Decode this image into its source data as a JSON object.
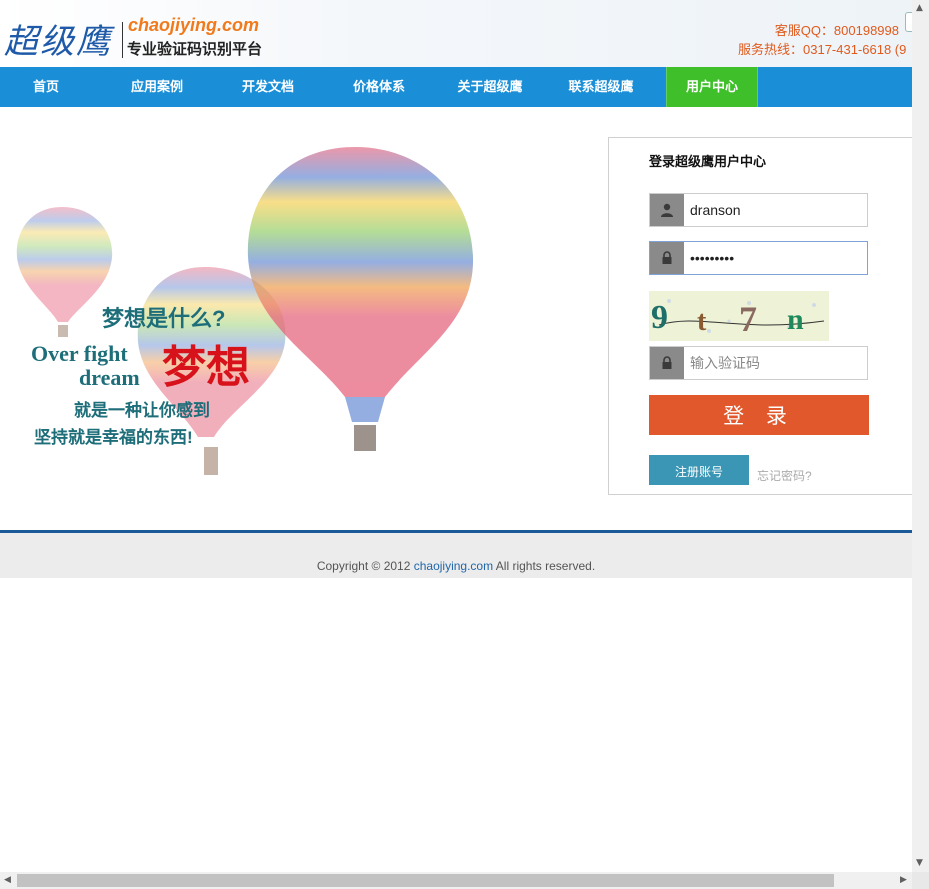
{
  "header": {
    "logo_cn": "超级鹰",
    "logo_domain": "chaojiying.com",
    "logo_slogan": "专业验证码识别平台",
    "contact_qq": "客服QQ：800198998",
    "contact_phone": "服务热线：0317-431-6618 (9"
  },
  "nav": {
    "items": [
      {
        "label": "首页"
      },
      {
        "label": "应用案例"
      },
      {
        "label": "开发文档"
      },
      {
        "label": "价格体系"
      },
      {
        "label": "关于超级鹰"
      },
      {
        "label": "联系超级鹰"
      },
      {
        "label": "用户中心",
        "active": true
      }
    ]
  },
  "banner": {
    "question": "梦想是什么?",
    "english_line1": "Over fight",
    "english_line2": "dream",
    "dream": "梦想",
    "line1": "就是一种让你感到",
    "line2": "坚持就是幸福的东西!"
  },
  "login": {
    "title": "登录超级鹰用户中心",
    "username_value": "dranson",
    "password_value": "•••••••••",
    "captcha_text": "9 t 7 n",
    "captcha_placeholder": "输入验证码",
    "login_button": "登 录",
    "register_button": "注册账号",
    "forgot_link": "忘记密码?"
  },
  "footer": {
    "prefix": "Copyright © 2012 ",
    "link": "chaojiying.com",
    "suffix": " All rights reserved."
  },
  "colors": {
    "nav_bg": "#1a8fd7",
    "nav_active": "#3fbf2a",
    "login_button": "#e0582b",
    "register_button": "#3a96b4",
    "accent_orange": "#f07a1c"
  }
}
